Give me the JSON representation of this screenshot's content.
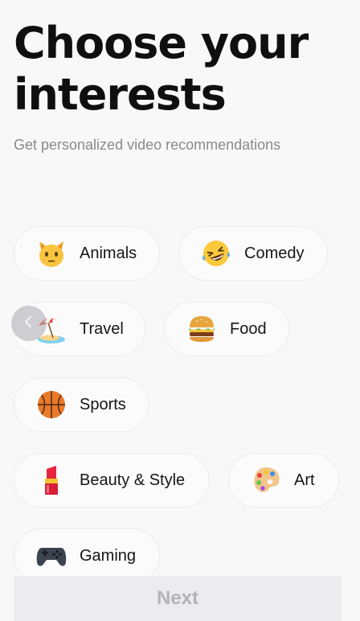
{
  "header": {
    "title_line1": "Choose your",
    "title_line2": "interests",
    "subtitle": "Get personalized video recommendations"
  },
  "interests": [
    {
      "label": "Animals",
      "icon": "cat-face-icon"
    },
    {
      "label": "Comedy",
      "icon": "laughing-face-icon"
    },
    {
      "label": "Travel",
      "icon": "beach-umbrella-icon"
    },
    {
      "label": "Food",
      "icon": "burger-icon"
    },
    {
      "label": "Sports",
      "icon": "basketball-icon"
    },
    {
      "label": "Beauty & Style",
      "icon": "lipstick-icon"
    },
    {
      "label": "Art",
      "icon": "palette-icon"
    },
    {
      "label": "Gaming",
      "icon": "game-controller-icon"
    }
  ],
  "back_button": {
    "icon": "chevron-left-icon"
  },
  "footer": {
    "next_label": "Next"
  },
  "colors": {
    "background": "#f8f8f9",
    "chip_border": "#ececee",
    "next_bar": "#ececee",
    "next_text": "#b4b4b8",
    "subtitle": "#8a8a8e"
  }
}
